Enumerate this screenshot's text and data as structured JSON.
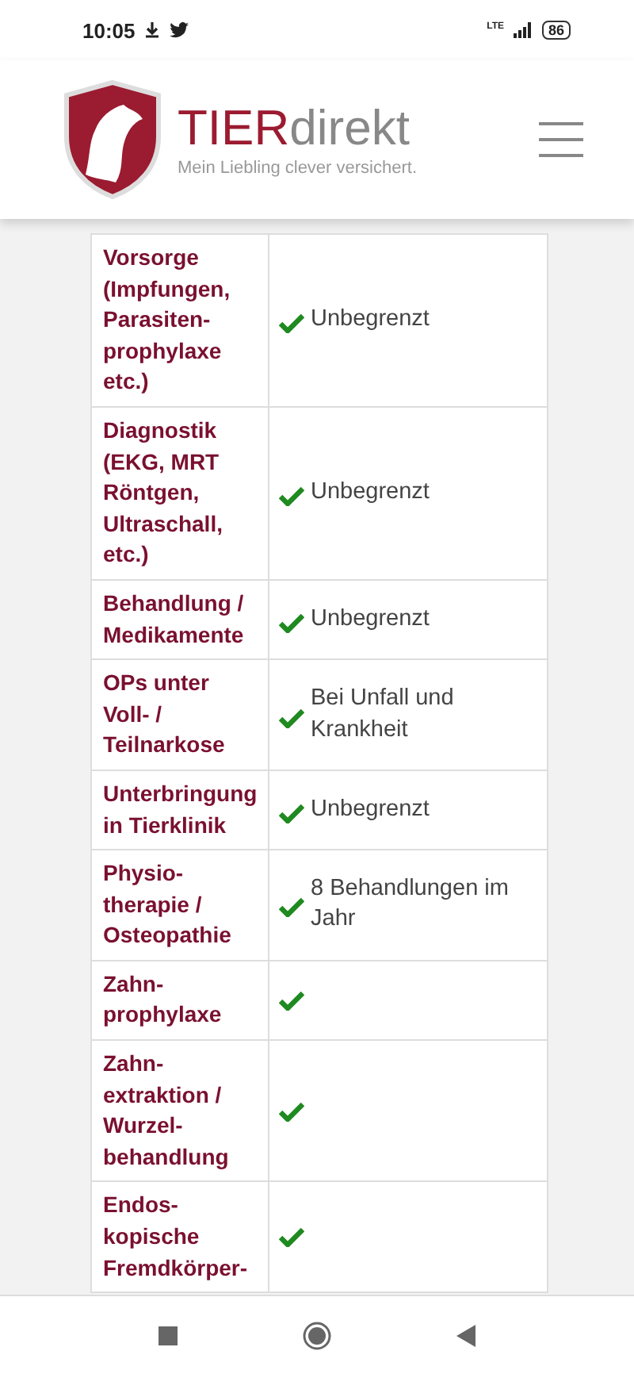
{
  "status_bar": {
    "time": "10:05",
    "network": "LTE",
    "battery": "86"
  },
  "header": {
    "brand_first": "TIER",
    "brand_second": "direkt",
    "tagline": "Mein Liebling clever versichert."
  },
  "table": {
    "rows": [
      {
        "label": "Vorsorge\n(Impfungen,\nParasiten-\nprophylaxe\netc.)",
        "kind": "text",
        "value": "Unbegrenzt"
      },
      {
        "label": "Diagnostik\n(EKG, MRT\nRöntgen,\nUltraschall,\netc.)",
        "kind": "text",
        "value": "Unbegrenzt"
      },
      {
        "label": "Behandlung /\nMedikamente",
        "kind": "text",
        "value": "Unbegrenzt"
      },
      {
        "label": "OPs unter\nVoll- /\nTeilnarkose",
        "kind": "text",
        "value": "Bei Unfall und\nKrankheit"
      },
      {
        "label": "Unterbringung\nin Tierklinik",
        "kind": "text",
        "value": "Unbegrenzt"
      },
      {
        "label": "Physio-\ntherapie /\nOsteopathie",
        "kind": "text",
        "value": "8 Behandlungen im\nJahr"
      },
      {
        "label": "Zahn-\nprophylaxe",
        "kind": "check"
      },
      {
        "label": "Zahn-\nextraktion /\nWurzel-\nbehandlung",
        "kind": "check"
      },
      {
        "label": "Endos-\nkopische\nFremdkörper-",
        "kind": "check"
      }
    ]
  }
}
